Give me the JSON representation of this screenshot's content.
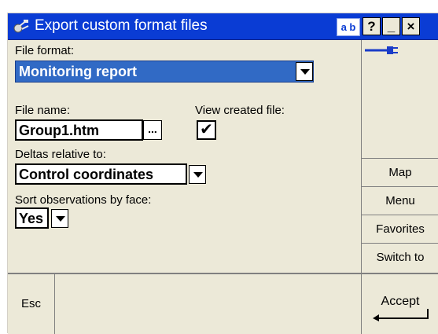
{
  "window": {
    "title": "Export custom format files",
    "keyboard_toggle": "a b",
    "help_label": "?",
    "minimize_label": "_",
    "close_label": "×"
  },
  "form": {
    "file_format_label": "File format:",
    "file_format_value": "Monitoring report",
    "file_name_label": "File name:",
    "file_name_value": "Group1.htm",
    "browse_label": "...",
    "view_created_label": "View created file:",
    "view_created_checked": true,
    "view_created_mark": "✔",
    "deltas_label": "Deltas relative to:",
    "deltas_value": "Control coordinates",
    "sort_label": "Sort observations by face:",
    "sort_value": "Yes"
  },
  "side_menu": {
    "icon": "power-plug-icon",
    "items": [
      "Map",
      "Menu",
      "Favorites",
      "Switch to"
    ]
  },
  "bottom": {
    "esc_label": "Esc",
    "accept_label": "Accept"
  },
  "colors": {
    "titlebar": "#0a3cd4",
    "selection": "#316ac5",
    "panel": "#ece9d8"
  }
}
